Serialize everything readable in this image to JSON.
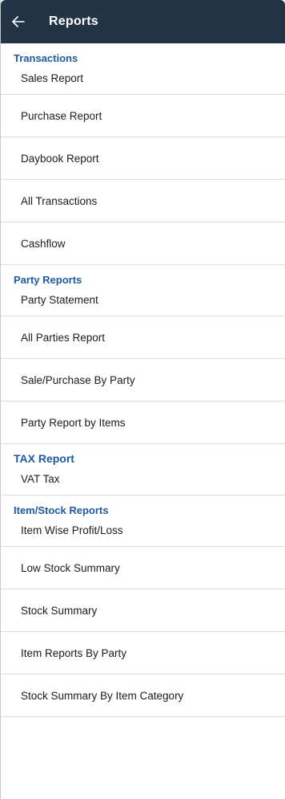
{
  "header": {
    "title": "Reports",
    "back_icon": "arrow-left-icon",
    "background": "#243447"
  },
  "accent_color": "#1f5aa6",
  "sections": [
    {
      "title": "Transactions",
      "items": [
        "Sales Report",
        "Purchase Report",
        "Daybook Report",
        "All Transactions",
        "Cashflow"
      ]
    },
    {
      "title": "Party Reports",
      "items": [
        "Party Statement",
        "All Parties Report",
        "Sale/Purchase By Party",
        "Party Report by Items"
      ]
    },
    {
      "title": "TAX Report",
      "items": [
        "VAT Tax"
      ]
    },
    {
      "title": "Item/Stock Reports",
      "items": [
        "Item Wise Profit/Loss",
        "Low Stock Summary",
        "Stock Summary",
        "Item Reports By Party",
        "Stock Summary By Item Category"
      ]
    }
  ]
}
